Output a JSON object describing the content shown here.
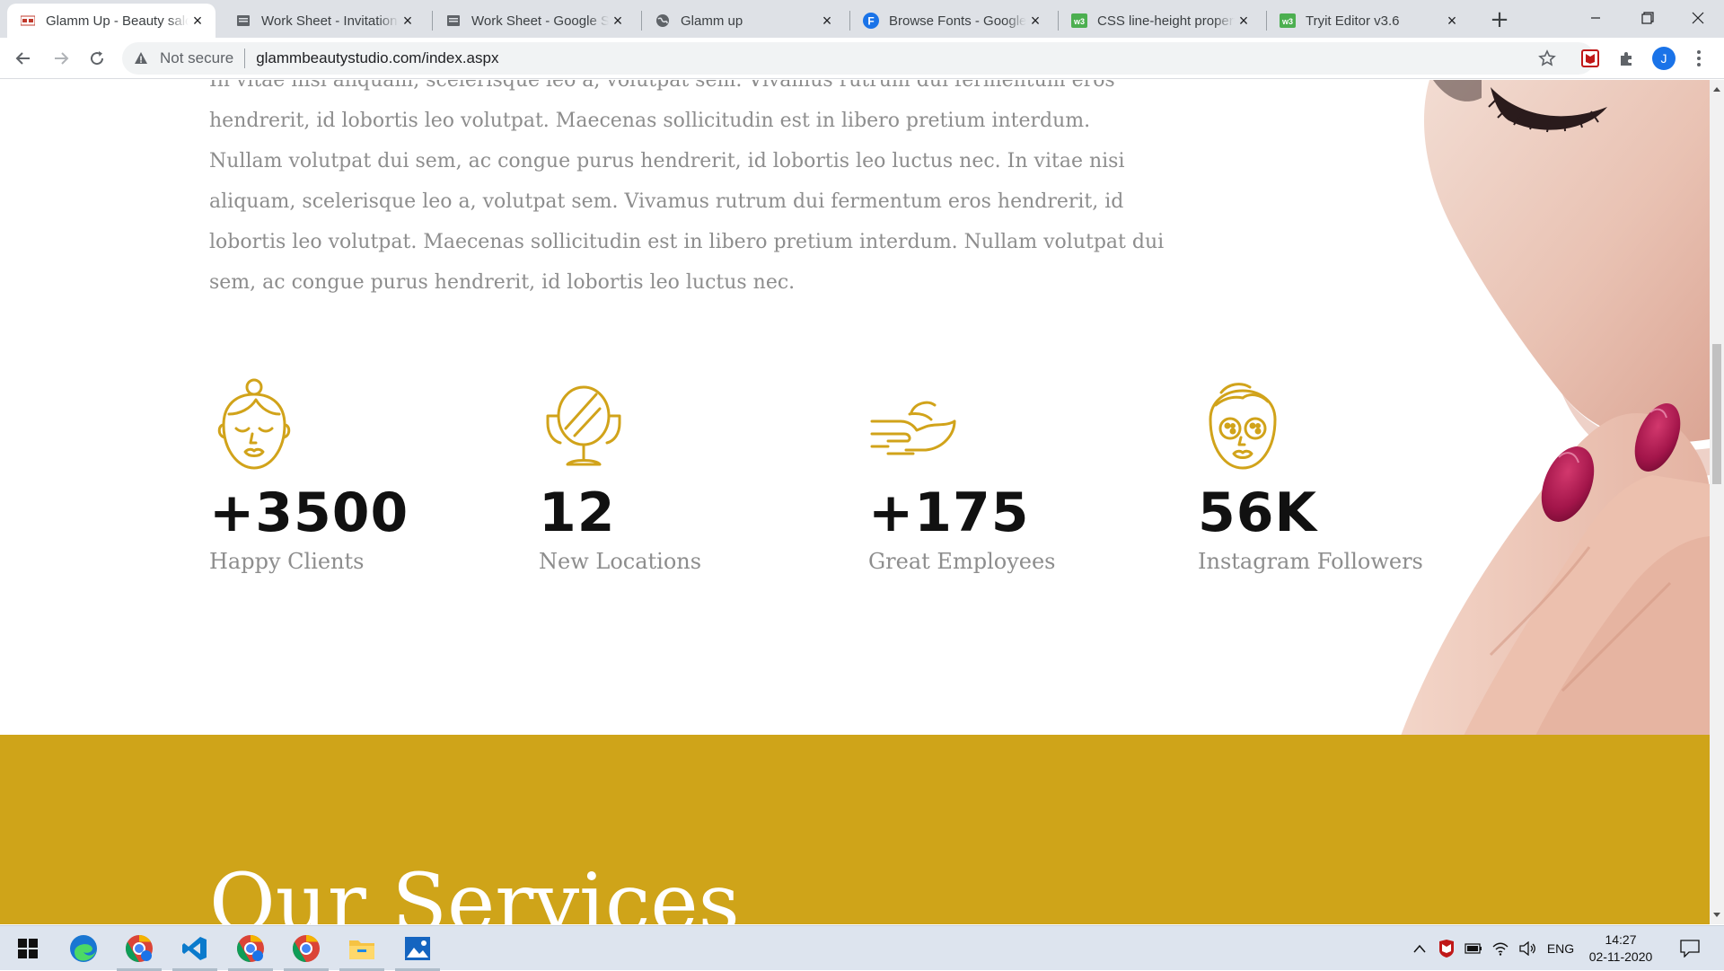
{
  "browser": {
    "tabs": [
      {
        "label": "Glamm Up - Beauty salon",
        "icon": "glamm-favicon",
        "active": true
      },
      {
        "label": "Work Sheet - Invitation",
        "icon": "sheets-icon"
      },
      {
        "label": "Work Sheet - Google Sheets",
        "icon": "sheets-icon"
      },
      {
        "label": "Glamm up",
        "icon": "globe-icon"
      },
      {
        "label": "Browse Fonts - Google Fonts",
        "icon": "google-fonts-icon"
      },
      {
        "label": "CSS line-height property",
        "icon": "w3schools-icon"
      },
      {
        "label": "Tryit Editor v3.6",
        "icon": "w3schools-icon"
      }
    ],
    "security_label": "Not secure",
    "url": "glammbeautystudio.com/index.aspx",
    "profile_initial": "J",
    "accent_color": "#1a73e8"
  },
  "page": {
    "intro_paragraph": "In vitae nisi aliquam, scelerisque leo a, volutpat sem. Vivamus rutrum dui fermentum eros hendrerit, id lobortis leo volutpat. Maecenas sollicitudin est in libero pretium interdum. Nullam volutpat dui sem, ac congue purus hendrerit, id lobortis leo luctus nec. In vitae nisi aliquam, scelerisque leo a, volutpat sem. Vivamus rutrum dui fermentum eros hendrerit, id lobortis leo volutpat. Maecenas sollicitudin est in libero pretium interdum. Nullam volutpat dui sem, ac congue purus hendrerit, id lobortis leo luctus nec.",
    "stats": [
      {
        "value": "+3500",
        "label": "Happy Clients",
        "icon": "woman-face-icon"
      },
      {
        "value": "12",
        "label": "New Locations",
        "icon": "vanity-mirror-icon"
      },
      {
        "value": "+175",
        "label": "Great Employees",
        "icon": "hand-cream-icon"
      },
      {
        "value": "56K",
        "label": "Instagram Followers",
        "icon": "face-mask-icon"
      }
    ],
    "services_title": "Our Services",
    "brand_gold": "#cfa419",
    "text_gray": "#8d8d8d"
  },
  "taskbar": {
    "apps": [
      "edge-icon",
      "chrome-profile-icon",
      "vscode-icon",
      "chrome-profile-icon",
      "chrome-icon",
      "file-explorer-icon",
      "photos-icon"
    ],
    "language": "ENG",
    "time": "14:27",
    "date": "02-11-2020"
  }
}
